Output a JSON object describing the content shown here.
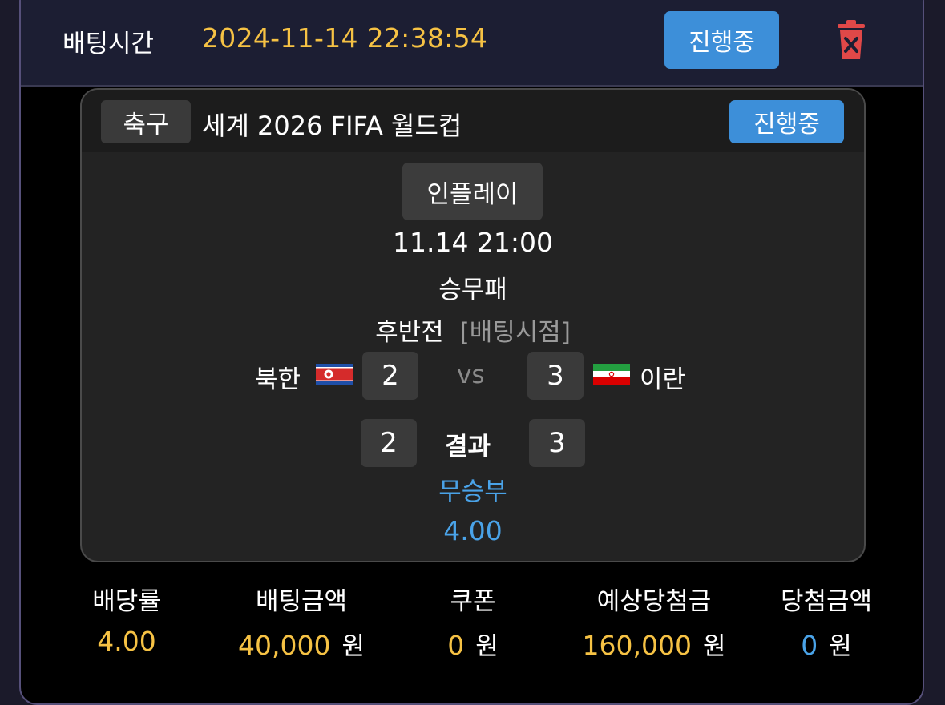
{
  "header": {
    "label": "배팅시간",
    "datetime": "2024-11-14 22:38:54",
    "status": "진행중",
    "delete_icon": "trash-icon"
  },
  "game": {
    "sport": "축구",
    "league": "세계 2026 FIFA 월드컵",
    "status": "진행중",
    "type_badge": "인플레이",
    "game_time": "11.14 21:00",
    "market": "승무패",
    "period": "후반전",
    "bet_point_label": "[배팅시점]",
    "home_team": "북한",
    "away_team": "이란",
    "home_score_at_bet": "2",
    "away_score_at_bet": "3",
    "vs": "vs",
    "result_label": "결과",
    "home_result": "2",
    "away_result": "3",
    "pick": "무승부",
    "pick_odds": "4.00"
  },
  "summary": {
    "odds_label": "배당률",
    "odds_value": "4.00",
    "amount_label": "배팅금액",
    "amount_value": "40,000",
    "coupon_label": "쿠폰",
    "coupon_value": "0",
    "expected_label": "예상당첨금",
    "expected_value": "160,000",
    "win_label": "당첨금액",
    "win_value": "0",
    "currency": "원"
  },
  "colors": {
    "accent_blue": "#3d8fd9",
    "highlight_yellow": "#f6c244",
    "pick_blue": "#4aa3e8",
    "delete_red": "#e04848"
  }
}
